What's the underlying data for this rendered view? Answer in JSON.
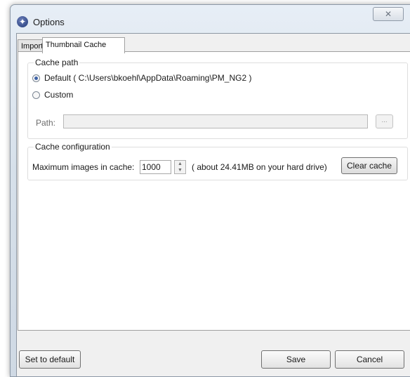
{
  "window": {
    "title": "Options",
    "close_symbol": "✕"
  },
  "tabs": [
    {
      "label": "Import",
      "active": false
    },
    {
      "label": "Thumbnail Cache",
      "active": true
    }
  ],
  "cache_path": {
    "legend": "Cache path",
    "default_label": "Default ( C:\\Users\\bkoehl\\AppData\\Roaming\\PM_NG2 )",
    "custom_label": "Custom",
    "selected": "default",
    "path_label": "Path:",
    "path_value": "",
    "browse_label": "..."
  },
  "cache_config": {
    "legend": "Cache configuration",
    "max_images_label": "Maximum images in cache:",
    "max_images_value": "1000",
    "size_note": "( about 24.41MB on your hard drive)",
    "clear_cache_label": "Clear cache"
  },
  "footer": {
    "set_default_label": "Set to default",
    "save_label": "Save",
    "cancel_label": "Cancel"
  }
}
